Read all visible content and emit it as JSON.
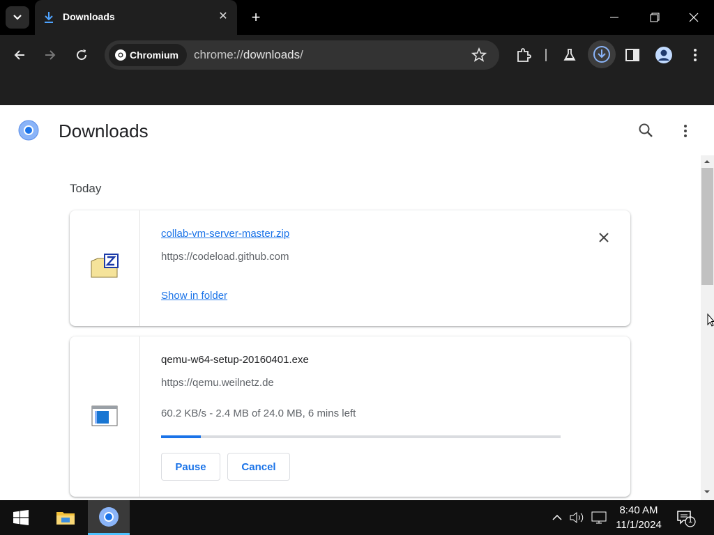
{
  "browser": {
    "tab": {
      "title": "Downloads",
      "close_glyph": "✕"
    },
    "new_tab_glyph": "+",
    "omnibox": {
      "chip_label": "Chromium",
      "url_scheme": "chrome://",
      "url_host": "downloads",
      "url_rest": "/"
    },
    "icons": {
      "tab_search": "chevron-down-icon",
      "back": "arrow-left-icon",
      "forward": "arrow-right-icon",
      "reload": "reload-icon",
      "bookmark": "star-icon",
      "extensions": "puzzle-icon",
      "labs": "flask-icon",
      "downloads": "download-icon",
      "side_panel": "side-panel-icon",
      "profile": "avatar-icon",
      "menu": "kebab-menu-icon"
    },
    "window_controls": [
      "minimize",
      "restore",
      "close"
    ]
  },
  "page": {
    "title": "Downloads",
    "section_date": "Today",
    "downloads": [
      {
        "file_name": "collab-vm-server-master.zip",
        "source": "https://codeload.github.com",
        "action": "Show in folder",
        "icon": "zip-file-icon",
        "state": "complete"
      },
      {
        "file_name": "qemu-w64-setup-20160401.exe",
        "source": "https://qemu.weilnetz.de",
        "progress_text": "60.2 KB/s - 2.4 MB of 24.0 MB, 6 mins left",
        "progress_fraction": 0.1,
        "buttons": {
          "pause": "Pause",
          "cancel": "Cancel"
        },
        "icon": "exe-file-icon",
        "state": "in-progress"
      }
    ]
  },
  "taskbar": {
    "apps": [
      "windows-start-icon",
      "file-explorer-icon",
      "chromium-icon"
    ],
    "clock": {
      "time": "8:40 AM",
      "date": "11/1/2024"
    },
    "notification_count": "1"
  },
  "colors": {
    "accent": "#1a73e8",
    "toolbar": "#1f1f1f",
    "taskbar_active": "#4cc2ff"
  }
}
